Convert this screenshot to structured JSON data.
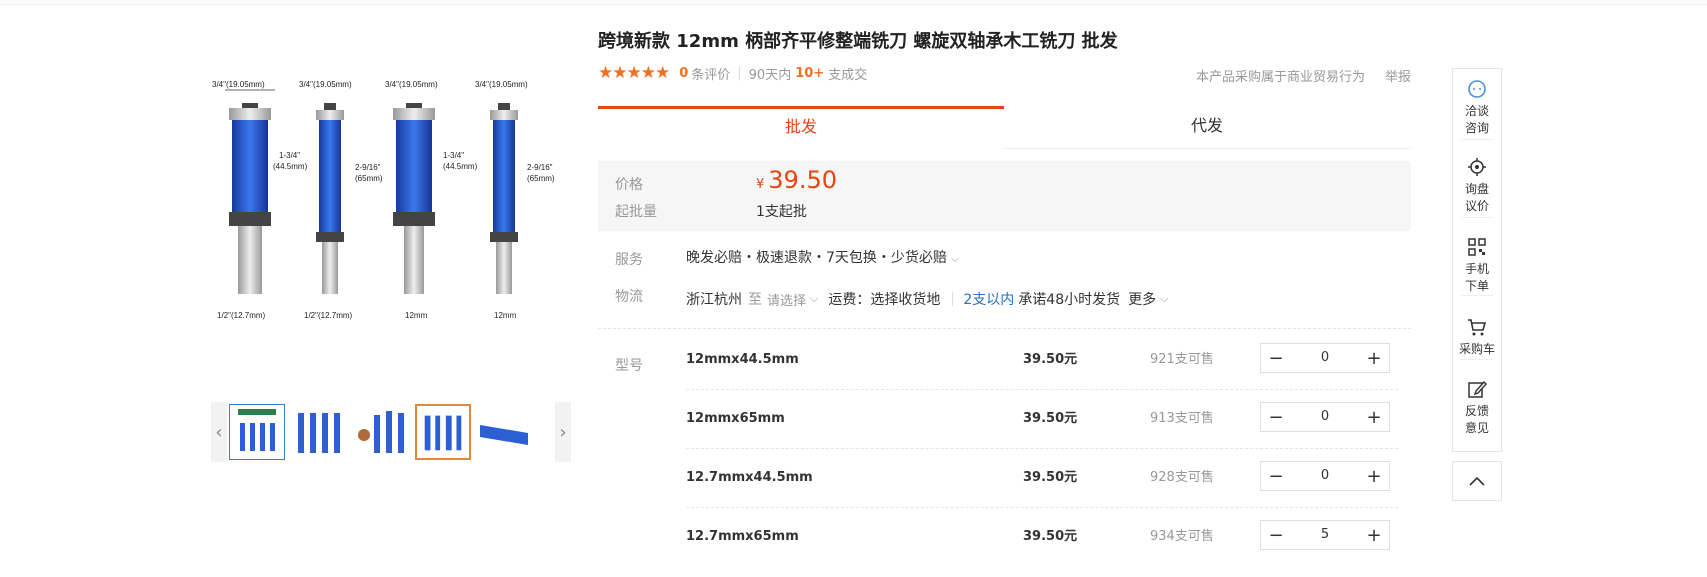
{
  "product": {
    "title": "跨境新款 12mm 柄部齐平修整端铣刀 螺旋双轴承木工铣刀 批发",
    "image_labels": {
      "top": [
        "3/4\"(19.05mm)",
        "3/4\"(19.05mm)",
        "3/4\"(19.05mm)",
        "3/4\"(19.05mm)"
      ],
      "mid": [
        "1-3/4\"",
        "(44.5mm)",
        "2-9/16\"",
        "(65mm)",
        "1-3/4\"",
        "(44.5mm)",
        "2-9/16\"",
        "(65mm)"
      ],
      "bottom": [
        "1/2\"(12.7mm)",
        "1/2\"(12.7mm)",
        "12mm",
        "12mm"
      ]
    }
  },
  "rating": {
    "stars": "★★★★★",
    "review_count": "0",
    "review_label": "条评价",
    "days_label": "90天内",
    "deals_count": "10+",
    "deals_label": "支成交"
  },
  "header_links": {
    "trade_note": "本产品采购属于商业贸易行为",
    "report": "举报"
  },
  "tabs": [
    {
      "label": "批发"
    },
    {
      "label": "代发"
    }
  ],
  "price": {
    "label": "价格",
    "currency": "¥",
    "value": "39.50",
    "moq_label": "起批量",
    "moq_value": "1支起批"
  },
  "service": {
    "label": "服务",
    "value": "晚发必赔・极速退款・7天包换・少货必赔"
  },
  "logistics": {
    "label": "物流",
    "origin": "浙江杭州",
    "to": "至",
    "select": "请选择",
    "freight": "运费：选择收货地",
    "qty_range": "2支以内",
    "promise": "承诺48小时发货",
    "more": "更多"
  },
  "model": {
    "label": "型号",
    "skus": [
      {
        "name": "12mmx44.5mm",
        "price": "39.50元",
        "stock": "921支可售",
        "qty": "0"
      },
      {
        "name": "12mmx65mm",
        "price": "39.50元",
        "stock": "913支可售",
        "qty": "0"
      },
      {
        "name": "12.7mmx44.5mm",
        "price": "39.50元",
        "stock": "928支可售",
        "qty": "0"
      },
      {
        "name": "12.7mmx65mm",
        "price": "39.50元",
        "stock": "934支可售",
        "qty": "5"
      }
    ],
    "minus": "−",
    "plus": "+"
  },
  "sidebar": {
    "items": [
      {
        "l1": "洽谈",
        "l2": "咨询"
      },
      {
        "l1": "询盘",
        "l2": "议价"
      },
      {
        "l1": "手机",
        "l2": "下单"
      },
      {
        "l1": "采购车",
        "l2": ""
      },
      {
        "l1": "反馈",
        "l2": "意见"
      }
    ]
  },
  "colors": {
    "accent": "#e6450f",
    "blue": "#2c6ec2",
    "tool_blue": "#1f4fc9"
  }
}
